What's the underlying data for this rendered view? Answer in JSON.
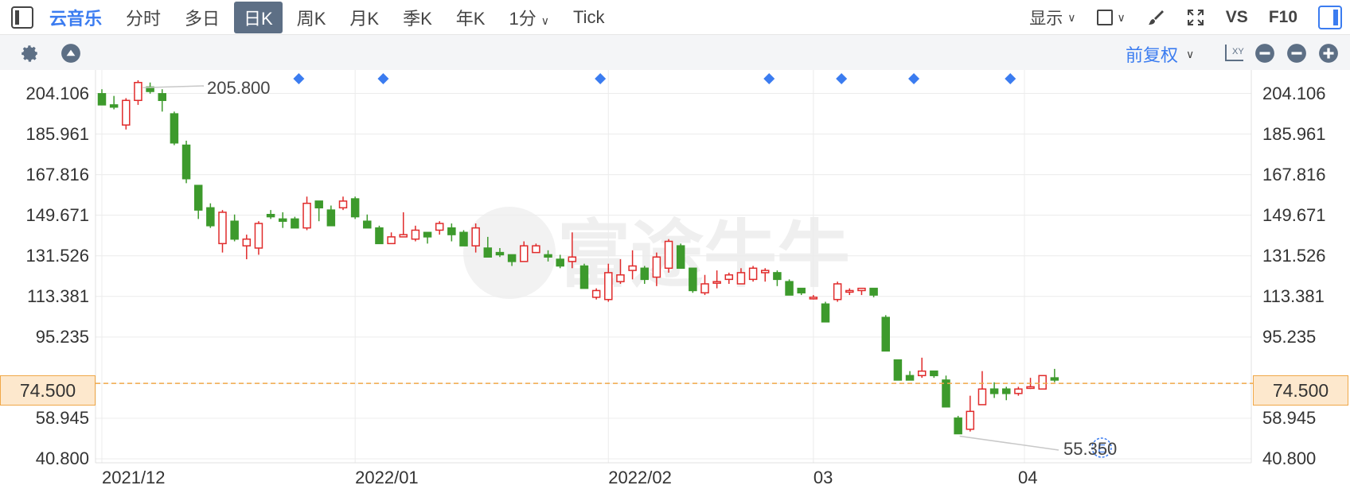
{
  "header": {
    "app_title": "云音乐",
    "tabs": [
      {
        "label": "分时",
        "active": false
      },
      {
        "label": "多日",
        "active": false
      },
      {
        "label": "日K",
        "active": true
      },
      {
        "label": "周K",
        "active": false
      },
      {
        "label": "月K",
        "active": false
      },
      {
        "label": "季K",
        "active": false
      },
      {
        "label": "年K",
        "active": false
      },
      {
        "label": "1分",
        "active": false,
        "dropdown": true
      },
      {
        "label": "Tick",
        "active": false
      }
    ],
    "display_label": "显示",
    "vs_label": "VS",
    "f10_label": "F10"
  },
  "toolbar": {
    "adjust_label": "前复权"
  },
  "colors": {
    "accent": "#3b7cf0",
    "up": "#e02b2b",
    "down": "#3d9a2c",
    "price_line": "#f0a848"
  },
  "chart_data": {
    "type": "candlestick",
    "y_ticks": [
      "204.106",
      "185.961",
      "167.816",
      "149.671",
      "131.526",
      "113.381",
      "95.235",
      "74.500",
      "58.945",
      "40.800"
    ],
    "x_labels": [
      "2021/12",
      "2022/01",
      "2022/02",
      "03",
      "04"
    ],
    "current_price": "74.500",
    "high_annotation": "205.800",
    "low_annotation": "55.350",
    "event_icon": "E",
    "watermark": "富途牛牛",
    "ylim": [
      40.8,
      213.18
    ],
    "candles": [
      [
        204,
        199,
        206,
        202
      ],
      [
        199,
        198,
        203,
        197
      ],
      [
        190,
        201,
        202,
        188
      ],
      [
        201,
        209,
        210,
        199
      ],
      [
        207,
        205,
        209,
        204
      ],
      [
        204,
        201,
        206,
        196
      ],
      [
        195,
        182,
        196,
        181
      ],
      [
        181,
        166,
        183,
        164
      ],
      [
        163,
        152,
        163,
        148
      ],
      [
        153,
        145,
        155,
        144
      ],
      [
        137,
        151,
        152,
        133
      ],
      [
        147,
        139,
        150,
        138
      ],
      [
        136,
        139,
        141,
        130
      ],
      [
        135,
        146,
        147,
        132
      ],
      [
        150,
        149,
        152,
        148
      ],
      [
        148,
        147,
        151,
        144
      ],
      [
        148,
        144,
        149,
        144
      ],
      [
        144,
        155,
        158,
        143
      ],
      [
        156,
        153,
        156,
        147
      ],
      [
        152,
        145,
        154,
        145
      ],
      [
        153,
        156,
        158,
        152
      ],
      [
        157,
        149,
        158,
        148
      ],
      [
        147,
        144,
        150,
        144
      ],
      [
        144,
        137,
        145,
        137
      ],
      [
        137,
        140,
        142,
        137
      ],
      [
        140,
        141,
        151,
        140
      ],
      [
        139,
        143,
        145,
        138
      ],
      [
        142,
        140,
        142,
        137
      ],
      [
        143,
        146,
        147,
        141
      ],
      [
        144,
        141,
        146,
        138
      ],
      [
        142,
        136,
        143,
        136
      ],
      [
        136,
        144,
        146,
        133
      ],
      [
        135,
        131,
        140,
        131
      ],
      [
        133,
        132,
        135,
        131
      ],
      [
        132,
        129,
        132,
        127
      ],
      [
        129,
        136,
        138,
        129
      ],
      [
        133,
        136,
        137,
        133
      ],
      [
        132,
        131,
        134,
        129
      ],
      [
        130,
        127,
        132,
        126
      ],
      [
        129,
        131,
        142,
        126
      ],
      [
        127,
        117,
        128,
        117
      ],
      [
        113,
        116,
        117,
        112
      ],
      [
        112,
        124,
        128,
        111
      ],
      [
        120,
        123,
        130,
        119
      ],
      [
        125,
        127,
        134,
        121
      ],
      [
        126,
        121,
        127,
        119
      ],
      [
        122,
        131,
        133,
        118
      ],
      [
        126,
        138,
        139,
        124
      ],
      [
        136,
        126,
        137,
        126
      ],
      [
        126,
        116,
        126,
        115
      ],
      [
        115,
        119,
        123,
        114
      ],
      [
        120,
        120,
        125,
        117
      ],
      [
        121,
        123,
        124,
        119
      ],
      [
        119,
        124,
        126,
        119
      ],
      [
        121,
        126,
        127,
        120
      ],
      [
        124,
        125,
        126,
        120
      ],
      [
        124,
        121,
        125,
        118
      ],
      [
        120,
        114,
        121,
        114
      ],
      [
        117,
        115,
        117,
        114
      ],
      [
        113,
        113,
        114,
        112
      ],
      [
        110,
        102,
        111,
        102
      ],
      [
        112,
        119,
        120,
        111
      ],
      [
        116,
        116,
        117,
        114
      ],
      [
        116,
        117,
        117,
        114
      ],
      [
        117,
        114,
        117,
        113
      ],
      [
        104,
        89,
        105,
        89
      ],
      [
        85,
        76,
        85,
        76
      ],
      [
        78,
        76,
        80,
        76
      ],
      [
        78,
        80,
        86,
        77
      ],
      [
        80,
        78,
        80,
        77
      ],
      [
        76,
        64,
        78,
        64
      ],
      [
        59,
        52,
        60,
        52
      ],
      [
        54,
        62,
        69,
        53
      ],
      [
        65,
        72,
        80,
        65
      ],
      [
        72,
        70,
        75,
        68
      ],
      [
        72,
        70,
        73,
        67
      ],
      [
        70,
        72,
        73,
        69
      ],
      [
        73,
        73,
        77,
        72
      ],
      [
        72,
        78,
        78,
        72
      ],
      [
        77,
        76,
        81,
        75
      ]
    ]
  }
}
